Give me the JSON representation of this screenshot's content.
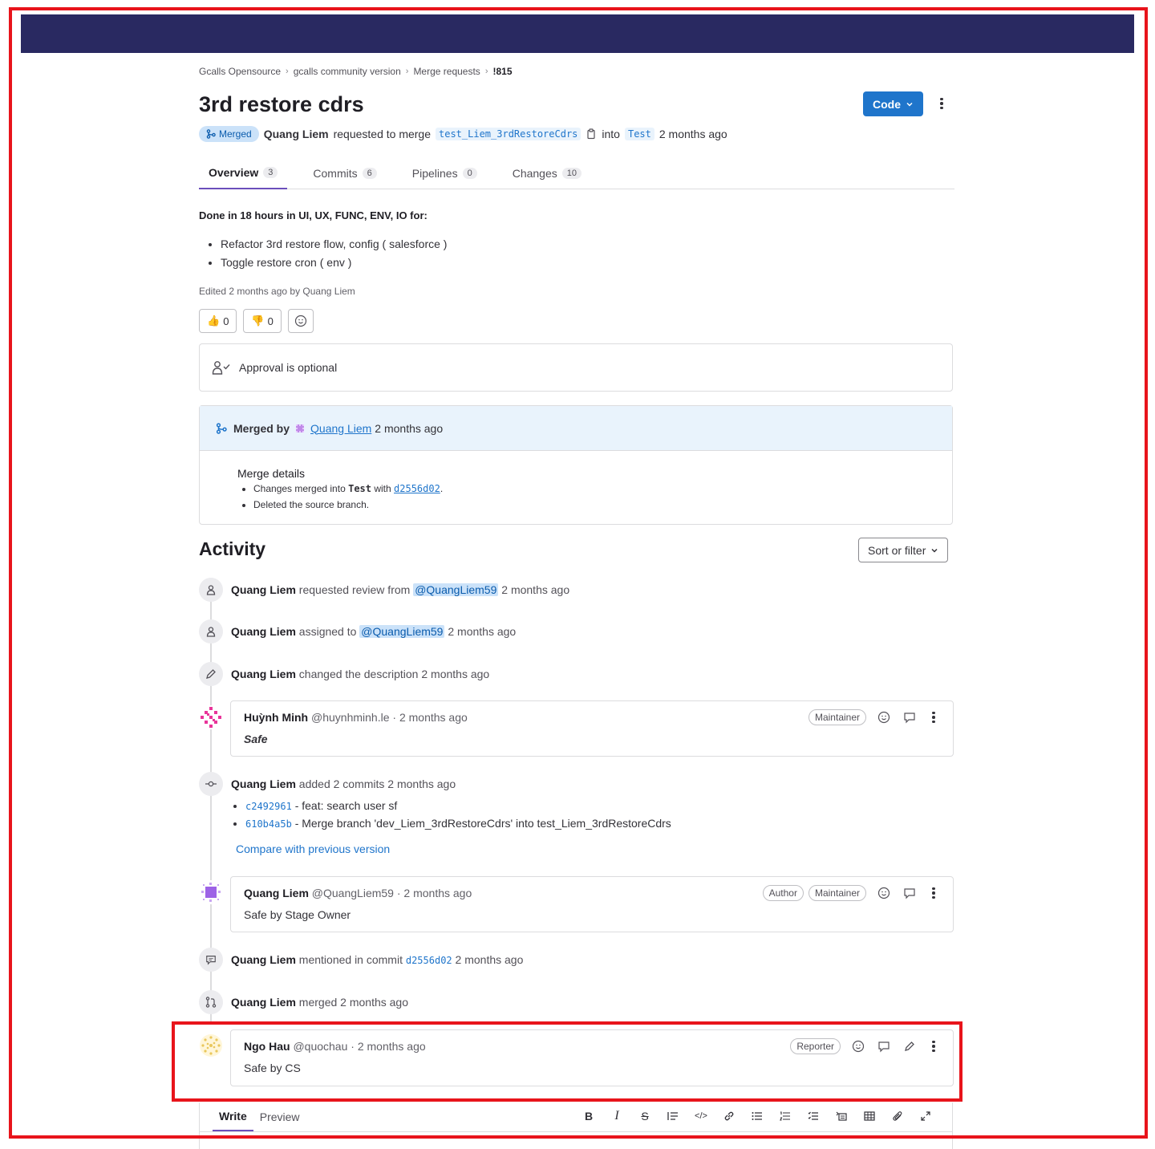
{
  "breadcrumb": [
    "Gcalls Opensource",
    "gcalls community version",
    "Merge requests",
    "!815"
  ],
  "mr": {
    "title": "3rd restore cdrs",
    "code_button": "Code",
    "status": "Merged",
    "author": "Quang Liem",
    "requested_text": "requested to merge",
    "source_branch": "test_Liem_3rdRestoreCdrs",
    "into_text": "into",
    "target_branch": "Test",
    "time": "2 months ago"
  },
  "tabs": [
    {
      "label": "Overview",
      "count": "3"
    },
    {
      "label": "Commits",
      "count": "6"
    },
    {
      "label": "Pipelines",
      "count": "0"
    },
    {
      "label": "Changes",
      "count": "10"
    }
  ],
  "description": {
    "heading": "Done in 18 hours in UI, UX, FUNC, ENV, IO for:",
    "items": [
      "Refactor 3rd restore flow, config ( salesforce )",
      "Toggle restore cron ( env )"
    ],
    "edited": "Edited 2 months ago by Quang Liem"
  },
  "reactions": {
    "thumbs_up": "0",
    "thumbs_down": "0"
  },
  "approval": {
    "text": "Approval is optional"
  },
  "merged_box": {
    "merged_by_label": "Merged by",
    "user": "Quang Liem",
    "time": "2 months ago",
    "details_title": "Merge details",
    "line1_prefix": "Changes merged into",
    "line1_branch": "Test",
    "line1_with": "with",
    "line1_sha": "d2556d02",
    "line2": "Deleted the source branch."
  },
  "activity": {
    "title": "Activity",
    "sort_label": "Sort or filter",
    "events": [
      {
        "user": "Quang Liem",
        "text": "requested review from",
        "mention": "@QuangLiem59",
        "time": "2 months ago"
      },
      {
        "user": "Quang Liem",
        "text": "assigned to",
        "mention": "@QuangLiem59",
        "time": "2 months ago"
      },
      {
        "user": "Quang Liem",
        "text": "changed the description",
        "time": "2 months ago"
      },
      {
        "user": "Quang Liem",
        "text": "added 2 commits",
        "time": "2 months ago"
      },
      {
        "user": "Quang Liem",
        "text": "mentioned in commit",
        "sha": "d2556d02",
        "time": "2 months ago"
      },
      {
        "user": "Quang Liem",
        "text": "merged",
        "time": "2 months ago"
      }
    ],
    "commits": [
      {
        "sha": "c2492961",
        "message": "- feat: search user sf"
      },
      {
        "sha": "610b4a5b",
        "message": "- Merge branch 'dev_Liem_3rdRestoreCdrs' into test_Liem_3rdRestoreCdrs"
      }
    ],
    "compare_link": "Compare with previous version",
    "notes": [
      {
        "name": "Huỳnh Minh",
        "handle": "@huynhminh.le",
        "time": "· 2 months ago",
        "roles": [
          "Maintainer"
        ],
        "body": "Safe"
      },
      {
        "name": "Quang Liem",
        "handle": "@QuangLiem59",
        "time": "· 2 months ago",
        "roles": [
          "Author",
          "Maintainer"
        ],
        "body": "Safe by Stage Owner"
      },
      {
        "name": "Ngo Hau",
        "handle": "@quochau",
        "time": "· 2 months ago",
        "roles": [
          "Reporter"
        ],
        "body": "Safe by CS"
      }
    ]
  },
  "editor": {
    "write": "Write",
    "preview": "Preview"
  },
  "colors": {
    "topbar": "#292961",
    "accent": "#1f75cb",
    "highlight": "#e8141b",
    "tab_underline": "#6b4fbb"
  }
}
